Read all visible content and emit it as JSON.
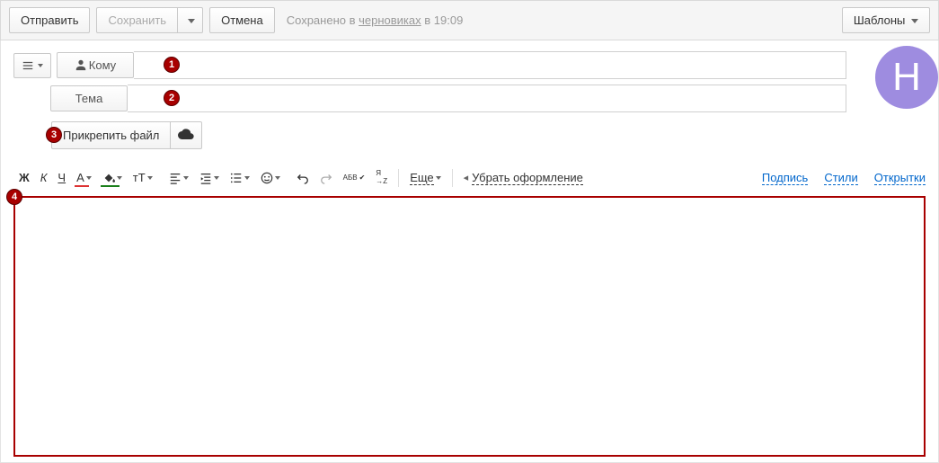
{
  "top": {
    "send": "Отправить",
    "save": "Сохранить",
    "cancel": "Отмена",
    "saved_prefix": "Сохранено в ",
    "saved_link": "черновиках",
    "saved_time": " в 19:09",
    "templates": "Шаблоны"
  },
  "fields": {
    "to_label": "Кому",
    "subject_label": "Тема"
  },
  "attach": {
    "label": "Прикрепить файл"
  },
  "markers": {
    "m1": "1",
    "m2": "2",
    "m3": "3",
    "m4": "4"
  },
  "avatar_letter": "Н",
  "toolbar": {
    "bold": "Ж",
    "italic": "К",
    "underline": "Ч",
    "textcolor": "А",
    "fillcolor": "А",
    "fontsize": "тТ",
    "spellcheck": "АБВ",
    "translit": "Я→Z",
    "more": "Еще",
    "clear": "Убрать оформление",
    "signature": "Подпись",
    "styles": "Стили",
    "cards": "Открытки"
  }
}
